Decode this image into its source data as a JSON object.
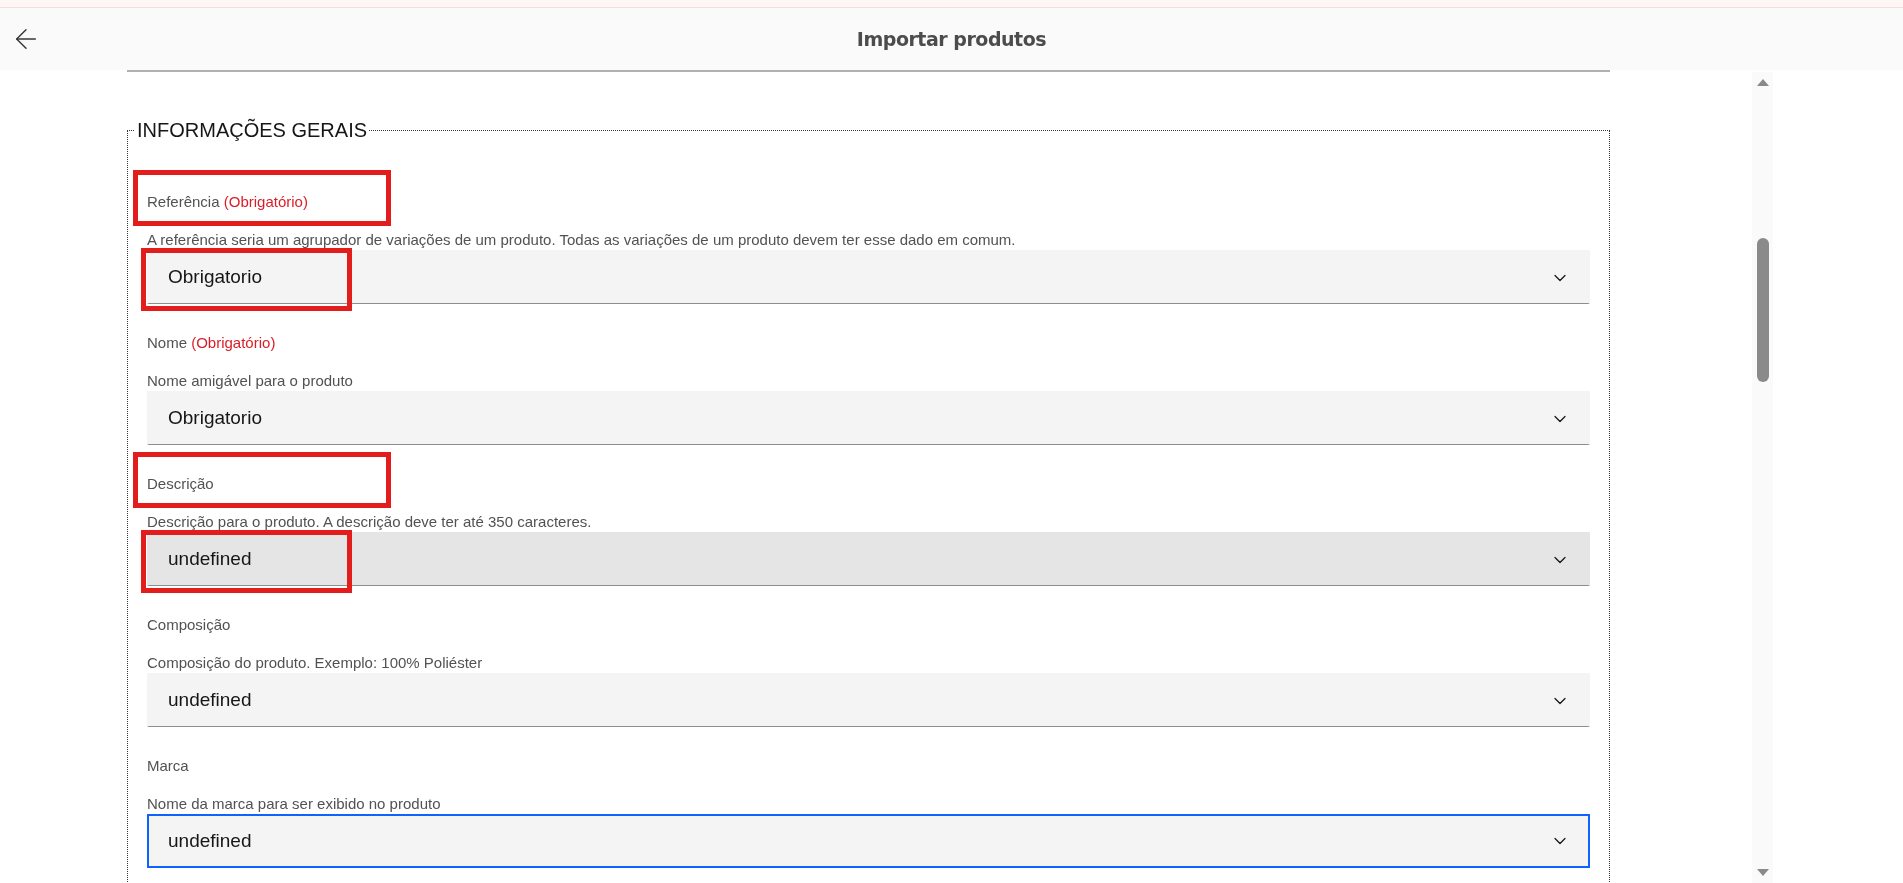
{
  "header": {
    "title": "Importar produtos"
  },
  "section": {
    "title": "INFORMAÇÕES GERAIS",
    "fields": [
      {
        "label": "Referência",
        "required_note": "(Obrigatório)",
        "help": "A referência seria um agrupador de variações de um produto. Todas as variações de um produto devem ter esse dado em comum.",
        "value": "Obrigatorio",
        "hovered": false,
        "focused": false,
        "label_highlighted": true,
        "select_highlighted": true
      },
      {
        "label": "Nome",
        "required_note": "(Obrigatório)",
        "help": "Nome amigável para o produto",
        "value": "Obrigatorio",
        "hovered": false,
        "focused": false,
        "label_highlighted": false,
        "select_highlighted": false
      },
      {
        "label": "Descrição",
        "help": "Descrição para o produto. A descrição deve ter até 350 caracteres.",
        "value": "undefined",
        "hovered": true,
        "focused": false,
        "label_highlighted": true,
        "select_highlighted": true
      },
      {
        "label": "Composição",
        "help": "Composição do produto. Exemplo: 100% Poliéster",
        "value": "undefined",
        "hovered": false,
        "focused": false,
        "label_highlighted": false,
        "select_highlighted": false
      },
      {
        "label": "Marca",
        "help": "Nome da marca para ser exibido no produto",
        "value": "undefined",
        "hovered": false,
        "focused": true,
        "label_highlighted": false,
        "select_highlighted": false
      }
    ]
  }
}
